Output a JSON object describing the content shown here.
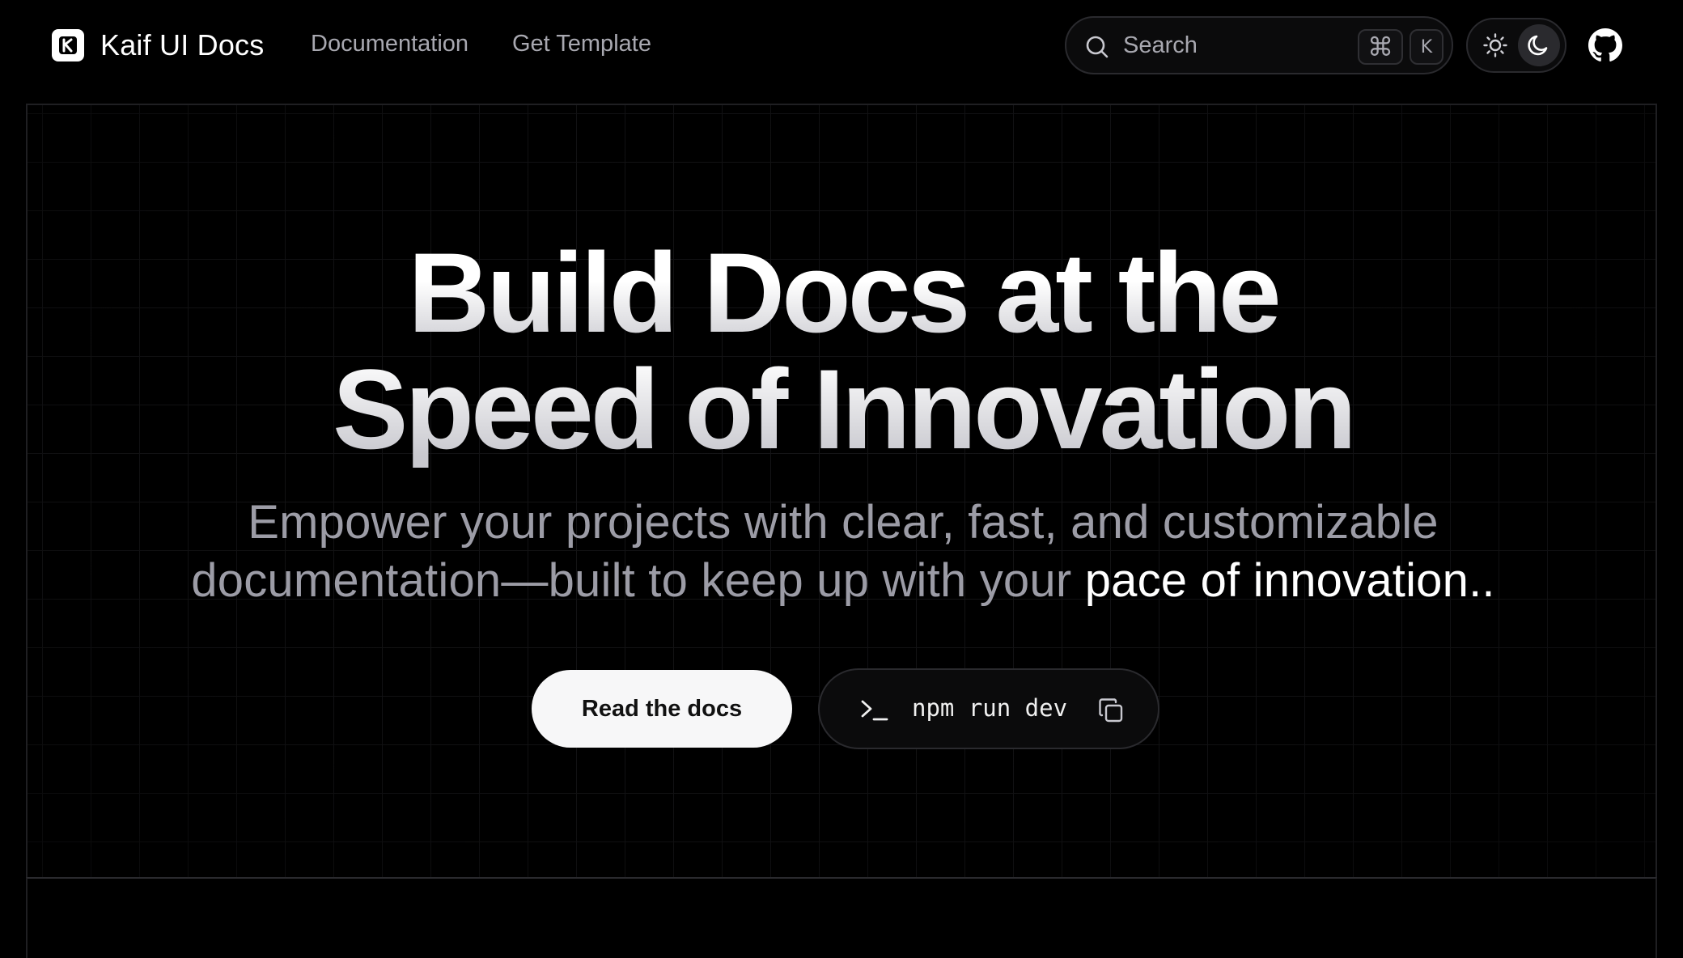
{
  "header": {
    "brand": {
      "name": "Kaif UI Docs",
      "logo_icon": "k-logo-icon"
    },
    "nav": [
      {
        "label": "Documentation"
      },
      {
        "label": "Get Template"
      }
    ],
    "search": {
      "placeholder": "Search",
      "shortcut_keys": [
        "⌘",
        "K"
      ]
    },
    "theme_toggle": {
      "options": [
        "light",
        "dark"
      ],
      "selected": "dark"
    },
    "github_icon": "github-icon"
  },
  "hero": {
    "title_lines": [
      "Build Docs at the",
      "Speed of Innovation"
    ],
    "subtitle": {
      "line1": "Empower your projects with clear, fast, and customizable",
      "line2_plain": "documentation—built to keep up with your ",
      "line2_highlight": "pace of innovation.."
    },
    "cta": {
      "primary_label": "Read the docs",
      "command": "npm run dev",
      "command_icon": "terminal-prompt-icon",
      "copy_icon": "copy-icon"
    }
  },
  "colors": {
    "background": "#000000",
    "muted_text": "#9c9ca6",
    "button_bg": "#f7f7f8",
    "border": "#2a2a2e"
  }
}
